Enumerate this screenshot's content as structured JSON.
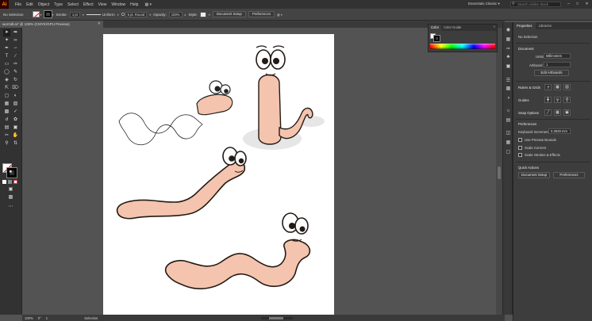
{
  "app": {
    "logo": "Ai"
  },
  "menu": {
    "items": [
      "File",
      "Edit",
      "Object",
      "Type",
      "Select",
      "Effect",
      "View",
      "Window",
      "Help"
    ],
    "extra_icon": "grid-arrange-icon"
  },
  "workspace": {
    "label": "Essentials Classic"
  },
  "search": {
    "placeholder": "Search Adobe Stock"
  },
  "window_controls": {
    "minimize": "–",
    "maximize": "□",
    "close": "✕"
  },
  "control": {
    "selection_label": "No Selection",
    "stroke_label": "Stroke:",
    "stroke_weight": "1 pt",
    "profile": "Uniform",
    "brush": "5 pt. Round",
    "opacity_label": "Opacity:",
    "opacity_value": "100%",
    "style_label": "Style:",
    "doc_setup_button": "Document Setup",
    "preferences_button": "Preferences"
  },
  "document": {
    "tab_title": "wormill.ai* @ 100% (CMYK/GPU Preview)",
    "close": "✕"
  },
  "status": {
    "zoom": "100%",
    "rotation": "0°",
    "artboard": "1",
    "tool": "Selection"
  },
  "color_panel": {
    "tabs": [
      "Color",
      "Color Guide"
    ],
    "close": "»"
  },
  "properties": {
    "tabs": [
      "Properties",
      "Libraries"
    ],
    "selection": "No Selection",
    "document_heading": "Document",
    "units_label": "Units",
    "units_value": "Millimeters",
    "artboard_label": "Artboard",
    "artboard_value": "1",
    "edit_artboards_button": "Edit Artboards",
    "rulers_grids_heading": "Rulers & Grids",
    "guides_heading": "Guides",
    "snap_options_heading": "Snap Options",
    "preferences_heading": "Preferences",
    "keyboard_increment_label": "Keyboard Increment:",
    "keyboard_increment_value": "0.3528 mm",
    "use_preview_bounds": "Use Preview Bounds",
    "scale_corners": "Scale Corners",
    "scale_strokes": "Scale Strokes & Effects",
    "quick_actions_heading": "Quick Actions",
    "document_setup_button": "Document Setup",
    "preferences_button": "Preferences"
  },
  "colors": {
    "worm_fill": "#f4c4ae",
    "worm_outline": "#231a15",
    "shadow": "#e6e6e6",
    "ui_dark": "#323232",
    "ui_panel": "#3d3d3d"
  }
}
